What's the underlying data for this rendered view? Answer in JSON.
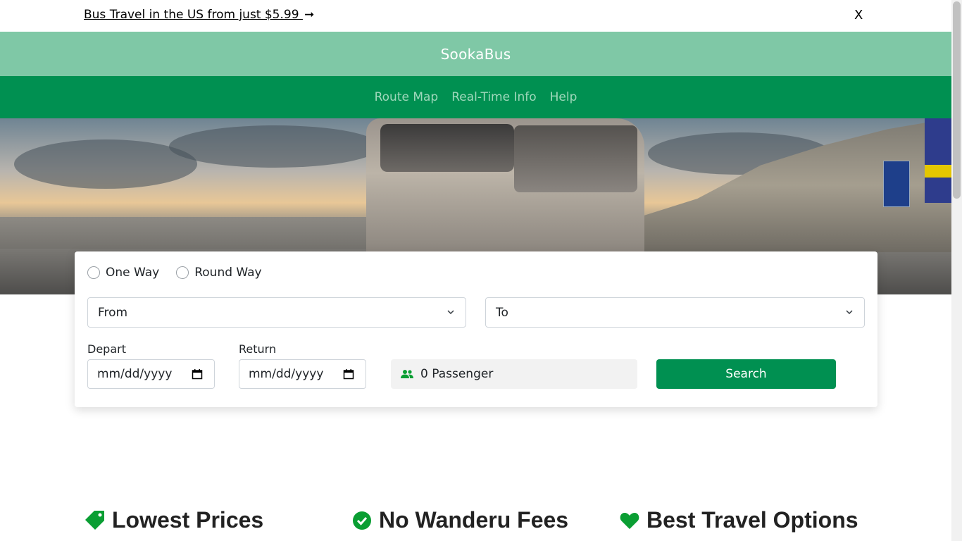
{
  "promo": {
    "text": "Bus Travel in the US from just $5.99 ",
    "arrow": "➞",
    "close": "X"
  },
  "brand": {
    "name": "SookaBus"
  },
  "nav": {
    "items": [
      "Route Map",
      "Real-Time Info",
      "Help"
    ]
  },
  "search": {
    "trip_types": [
      "One Way",
      "Round Way"
    ],
    "from_placeholder": "From",
    "to_placeholder": "To",
    "depart_label": "Depart",
    "return_label": "Return",
    "depart_value": "mm/dd/yyyy",
    "return_value": "mm/dd/yyyy",
    "passengers": "0 Passenger",
    "search_button": "Search"
  },
  "features": [
    "Lowest Prices",
    "No Wanderu Fees",
    "Best Travel Options"
  ],
  "colors": {
    "brand_bar": "#7fc8a6",
    "nav_bar": "#009051",
    "primary_button": "#009051",
    "feature_icon": "#0a9e33"
  }
}
